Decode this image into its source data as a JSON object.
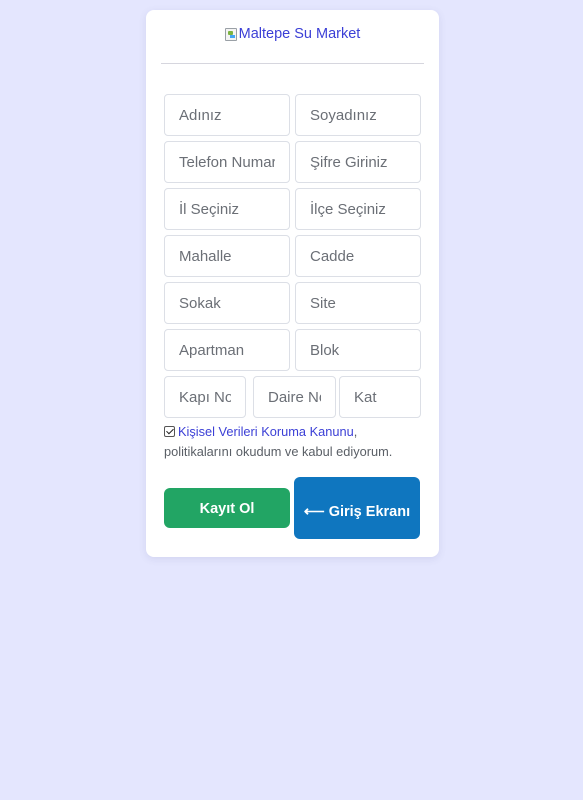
{
  "logo": {
    "alt_text": "Maltepe Su Market"
  },
  "form": {
    "first_name": {
      "placeholder": "Adınız"
    },
    "last_name": {
      "placeholder": "Soyadınız"
    },
    "phone": {
      "placeholder": "Telefon Numarası"
    },
    "password": {
      "placeholder": "Şifre Giriniz"
    },
    "province": {
      "placeholder": "İl Seçiniz"
    },
    "district": {
      "placeholder": "İlçe Seçiniz"
    },
    "neighborhood": {
      "placeholder": "Mahalle"
    },
    "avenue": {
      "placeholder": "Cadde"
    },
    "street": {
      "placeholder": "Sokak"
    },
    "site": {
      "placeholder": "Site"
    },
    "apartment": {
      "placeholder": "Apartman"
    },
    "block": {
      "placeholder": "Blok"
    },
    "door_no": {
      "placeholder": "Kapı No"
    },
    "flat_no": {
      "placeholder": "Daire No"
    },
    "floor": {
      "placeholder": "Kat"
    }
  },
  "consent": {
    "checked": true,
    "link_text": "Kişisel Verileri Koruma Kanunu",
    "separator": ",",
    "text": "politikalarını okudum ve kabul ediyorum."
  },
  "buttons": {
    "register_label": "Kayıt Ol",
    "login_label": "⟵ Giriş Ekranı"
  }
}
